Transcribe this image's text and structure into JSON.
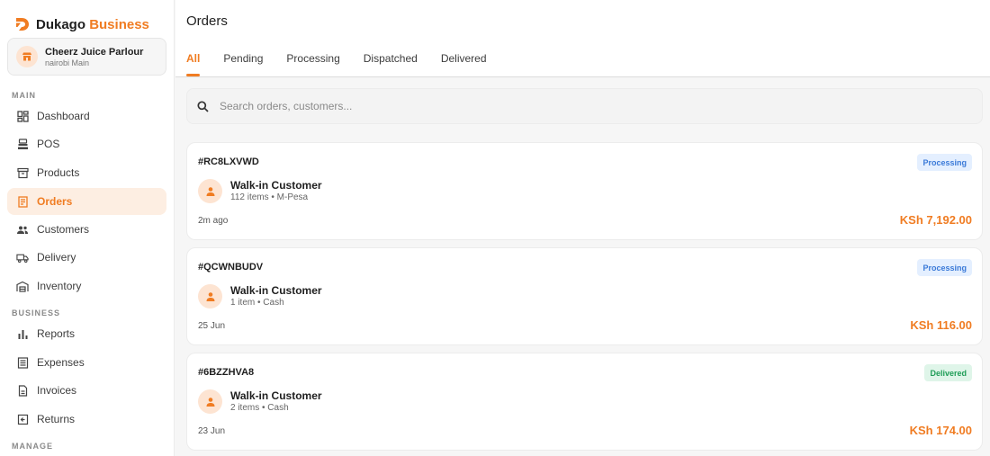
{
  "brand": {
    "name_prefix": "Dukago",
    "name_accent": "Business",
    "accent_color": "#f07c22"
  },
  "store": {
    "name": "Cheerz Juice Parlour",
    "branch": "nairobi Main",
    "icon": "store-icon"
  },
  "sidebar": {
    "sections": [
      {
        "label": "MAIN"
      },
      {
        "label": "BUSINESS"
      },
      {
        "label": "MANAGE"
      }
    ],
    "items": [
      {
        "label": "Dashboard",
        "icon": "dashboard-icon"
      },
      {
        "label": "POS",
        "icon": "pos-icon"
      },
      {
        "label": "Products",
        "icon": "products-icon"
      },
      {
        "label": "Orders",
        "icon": "orders-icon",
        "active": true
      },
      {
        "label": "Customers",
        "icon": "customers-icon"
      },
      {
        "label": "Delivery",
        "icon": "delivery-icon"
      },
      {
        "label": "Inventory",
        "icon": "inventory-icon"
      },
      {
        "label": "Reports",
        "icon": "reports-icon"
      },
      {
        "label": "Expenses",
        "icon": "expenses-icon"
      },
      {
        "label": "Invoices",
        "icon": "invoices-icon"
      },
      {
        "label": "Returns",
        "icon": "returns-icon"
      }
    ]
  },
  "header": {
    "title": "Orders"
  },
  "tabs": [
    {
      "label": "All",
      "active": true
    },
    {
      "label": "Pending"
    },
    {
      "label": "Processing"
    },
    {
      "label": "Dispatched"
    },
    {
      "label": "Delivered"
    }
  ],
  "search": {
    "placeholder": "Search orders, customers..."
  },
  "orders": [
    {
      "id": "#RC8LXVWD",
      "status": "Processing",
      "customer": "Walk-in Customer",
      "meta": "112 items • M-Pesa",
      "time": "2m ago",
      "amount": "KSh 7,192.00"
    },
    {
      "id": "#QCWNBUDV",
      "status": "Processing",
      "customer": "Walk-in Customer",
      "meta": "1 item • Cash",
      "time": "25 Jun",
      "amount": "KSh 116.00"
    },
    {
      "id": "#6BZZHVA8",
      "status": "Delivered",
      "customer": "Walk-in Customer",
      "meta": "2 items • Cash",
      "time": "23 Jun",
      "amount": "KSh 174.00"
    }
  ],
  "colors": {
    "processing_badge": "#3b7ad8",
    "delivered_badge": "#1f9d57"
  }
}
